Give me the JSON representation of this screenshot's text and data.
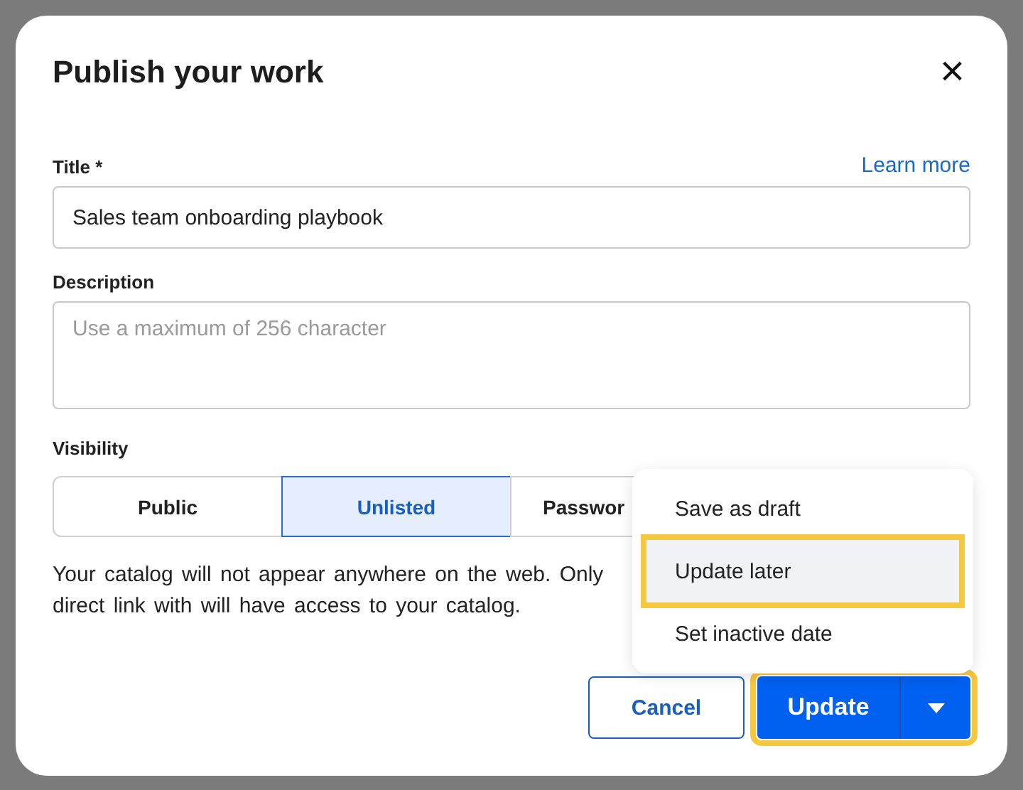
{
  "dialog": {
    "title": "Publish your work",
    "close": "×"
  },
  "learn_more": "Learn more",
  "title_field": {
    "label": "Title",
    "required": "*",
    "value": "Sales team onboarding playbook"
  },
  "description_field": {
    "label": "Description",
    "placeholder": "Use a maximum of 256 character"
  },
  "visibility": {
    "label": "Visibility",
    "options": [
      {
        "label": "Public",
        "selected": false
      },
      {
        "label": "Unlisted",
        "selected": true
      },
      {
        "label": "Passwor",
        "selected": false
      }
    ]
  },
  "visibility_note": [
    "Your catalog will not appear anywhere on the web. Only",
    "direct link with will have access to your catalog."
  ],
  "menu": [
    {
      "label": "Save as draft",
      "highlighted": false
    },
    {
      "label": "Update later",
      "highlighted": true
    },
    {
      "label": "Set inactive date",
      "highlighted": false
    }
  ],
  "buttons": {
    "cancel": "Cancel",
    "primary": "Update",
    "primary_highlighted": true
  }
}
